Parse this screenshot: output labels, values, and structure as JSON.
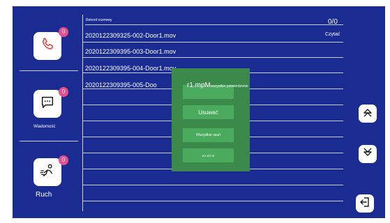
{
  "sidebar": {
    "calls": {
      "badge": "0",
      "label": ""
    },
    "messages": {
      "badge": "0",
      "label": "Wiadomość"
    },
    "motion": {
      "badge": "0",
      "label": "Ruch"
    }
  },
  "list": {
    "title": "Rekord rozmowy",
    "counter": "0/0",
    "read_label": "Czytać",
    "files": [
      "2020122309325-002-Door1.mov",
      "2020122309395-003-Door1.mov",
      "2020122309395-004-Door1.mov",
      "2020122309395-005-Doo"
    ],
    "overlay_suffix_left": "r1.m",
    "overlay_suffix_bold": "pM",
    "overlay_small": "wszystkie potwierdzenie"
  },
  "popup": {
    "btn_top": "",
    "btn_delete": "Usuwać",
    "btn_delete_all": "Wszystkie usuń",
    "btn_exit": "WYJŚCIE"
  },
  "colors": {
    "panel": "#1a2c92",
    "accent_pink": "#e5508f",
    "icon_red": "#e5443c",
    "popup_green": "#3b8a4c",
    "popup_button": "#4aaa5d"
  },
  "icons": {
    "calls": "phone-icon",
    "messages": "message-icon",
    "motion": "motion-icon",
    "up": "double-chevron-up-icon",
    "down": "double-chevron-down-icon",
    "exit": "exit-icon"
  }
}
